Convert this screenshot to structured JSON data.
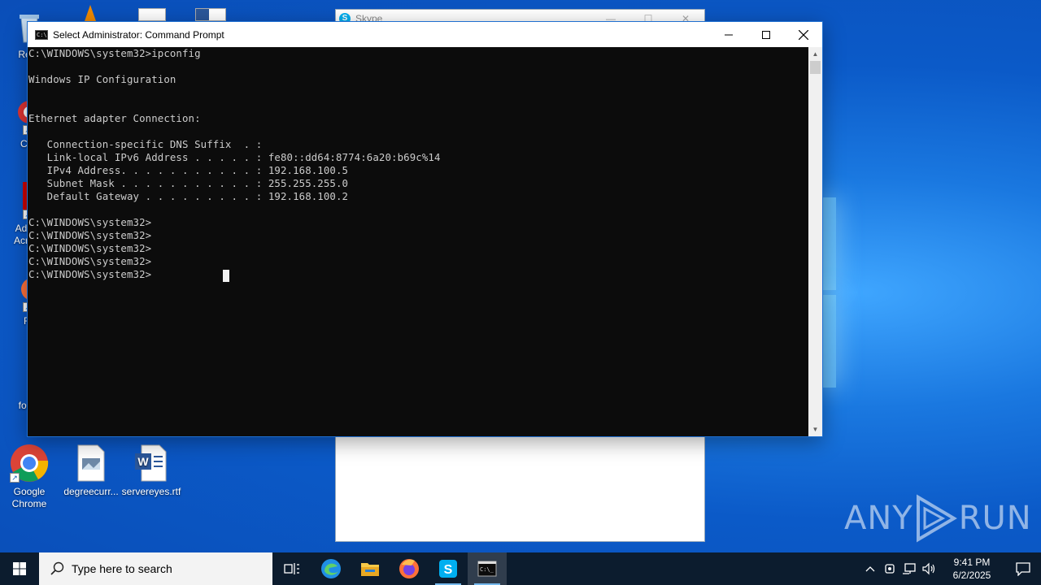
{
  "desktop": {
    "icons": [
      {
        "label": "Recy"
      },
      {
        "label": "CCl"
      },
      {
        "label": "Ad Acr"
      },
      {
        "label": "Fir"
      },
      {
        "label": "footb"
      },
      {
        "label": "Google Chrome"
      },
      {
        "label": "degreecurr..."
      },
      {
        "label": "servereyes.rtf"
      }
    ]
  },
  "skype_window": {
    "title": "Skype"
  },
  "cmd_window": {
    "title": "Select Administrator: Command Prompt",
    "lines": [
      "C:\\WINDOWS\\system32>ipconfig",
      "",
      "Windows IP Configuration",
      "",
      "",
      "Ethernet adapter Connection:",
      "",
      "   Connection-specific DNS Suffix  . :",
      "   Link-local IPv6 Address . . . . . : fe80::dd64:8774:6a20:b69c%14",
      "   IPv4 Address. . . . . . . . . . . : 192.168.100.5",
      "   Subnet Mask . . . . . . . . . . . : 255.255.255.0",
      "   Default Gateway . . . . . . . . . : 192.168.100.2",
      "",
      "C:\\WINDOWS\\system32>",
      "C:\\WINDOWS\\system32>",
      "C:\\WINDOWS\\system32>",
      "C:\\WINDOWS\\system32>",
      "C:\\WINDOWS\\system32>"
    ]
  },
  "taskbar": {
    "search_placeholder": "Type here to search",
    "apps": [
      "task-view",
      "edge",
      "file-explorer",
      "firefox",
      "skype",
      "command-prompt"
    ],
    "clock_time": "9:41 PM",
    "clock_date": "6/2/2025"
  },
  "watermark": {
    "text_left": "ANY",
    "text_right": "RUN"
  },
  "colors": {
    "cmd_bg": "#0c0c0c",
    "cmd_fg": "#cccccc",
    "taskbar": "#0c1c2e",
    "accent": "#1f6fd0"
  }
}
